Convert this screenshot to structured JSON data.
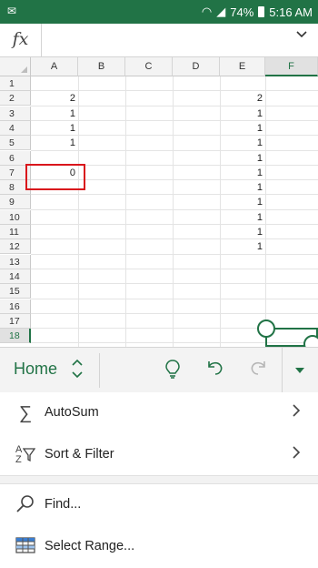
{
  "status": {
    "battery": "74%",
    "time": "5:16 AM"
  },
  "formula_bar": {
    "fx_label": "fx",
    "value": ""
  },
  "grid": {
    "columns": [
      "A",
      "B",
      "C",
      "D",
      "E",
      "F"
    ],
    "selected_column": "F",
    "rows": [
      "1",
      "2",
      "3",
      "4",
      "5",
      "6",
      "7",
      "8",
      "9",
      "10",
      "11",
      "12",
      "13",
      "14",
      "15",
      "16",
      "17",
      "18"
    ],
    "selected_row": "18",
    "col_a_values": {
      "2": "2",
      "3": "1",
      "4": "1",
      "5": "1",
      "7": "0"
    },
    "col_e_values": {
      "2": "2",
      "3": "1",
      "4": "1",
      "5": "1",
      "6": "1",
      "7": "1",
      "8": "1",
      "9": "1",
      "10": "1",
      "11": "1",
      "12": "1"
    },
    "highlight_color": "#d9161c",
    "selection_color": "#217346"
  },
  "ribbon": {
    "tab_label": "Home"
  },
  "menu": {
    "autosum": "AutoSum",
    "sort_filter": "Sort & Filter",
    "find": "Find...",
    "select_range": "Select Range..."
  },
  "icons": {
    "autosum": "sigma-icon",
    "sort": "sort-filter-icon",
    "find": "search-icon",
    "select_range": "table-icon"
  }
}
